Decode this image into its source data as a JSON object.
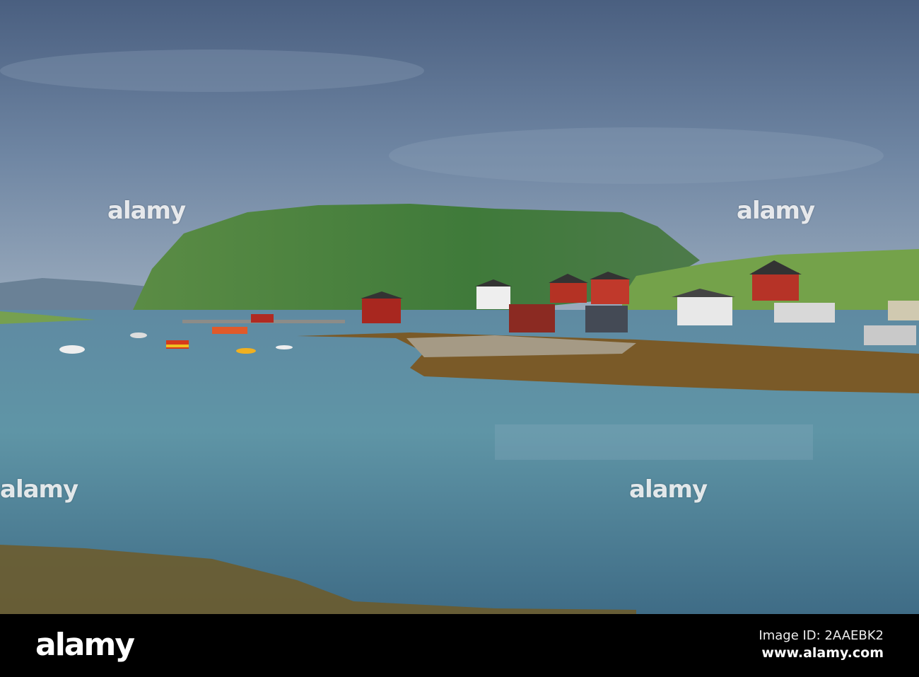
{
  "photo": {
    "watermark_text": "alamy",
    "colors": {
      "sky_top": "#4f6584",
      "sky_bottom": "#8fa2b9",
      "hill": "#4f8a3c",
      "water": "#5d8aa0",
      "seaweed": "#7a5a22",
      "house_red": "#b02a22"
    }
  },
  "footer": {
    "logo": "alamy",
    "image_id": "Image ID: 2AAEBK2",
    "url": "www.alamy.com"
  }
}
